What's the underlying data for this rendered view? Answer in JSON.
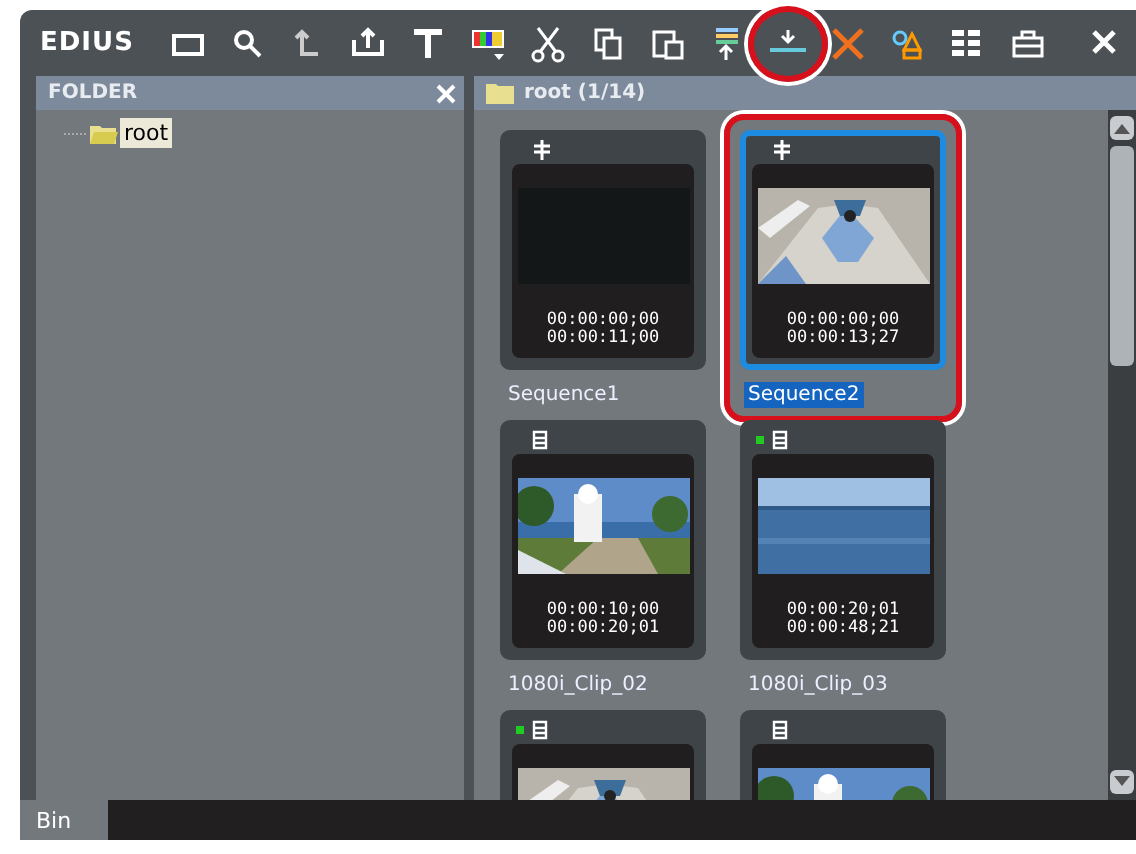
{
  "window": {
    "title": "EDIUS"
  },
  "toolbar": [
    {
      "kind": "new-folder"
    },
    {
      "kind": "search"
    },
    {
      "kind": "up"
    },
    {
      "kind": "export"
    },
    {
      "kind": "text"
    },
    {
      "kind": "color-bars"
    },
    {
      "kind": "cut"
    },
    {
      "kind": "copy"
    },
    {
      "kind": "paste"
    },
    {
      "kind": "add-timeline"
    },
    {
      "kind": "insert",
      "highlighted": true
    },
    {
      "kind": "delete"
    },
    {
      "kind": "properties"
    },
    {
      "kind": "view"
    },
    {
      "kind": "briefcase"
    }
  ],
  "folder_panel": {
    "title": "FOLDER",
    "tree": [
      {
        "label": "root",
        "selected": true
      }
    ]
  },
  "bin": {
    "path": "root (1/14)",
    "clips": [
      {
        "kind": "sequence",
        "name": "Sequence1",
        "in": "00:00:00;00",
        "out": "00:00:11;00",
        "marker": false,
        "selected": false,
        "highlighted": false
      },
      {
        "kind": "sequence",
        "name": "Sequence2",
        "in": "00:00:00;00",
        "out": "00:00:13;27",
        "marker": false,
        "selected": true,
        "highlighted": true
      },
      {
        "kind": "clip",
        "name": "1080i_Clip_02",
        "in": "00:00:10;00",
        "out": "00:00:20;01",
        "marker": false,
        "selected": false,
        "highlighted": false
      },
      {
        "kind": "clip",
        "name": "1080i_Clip_03",
        "in": "00:00:20;01",
        "out": "00:00:48;21",
        "marker": true,
        "selected": false,
        "highlighted": false
      },
      {
        "kind": "clip",
        "marker": true,
        "selected": false,
        "highlighted": false
      },
      {
        "kind": "clip",
        "marker": false,
        "selected": false,
        "highlighted": false
      }
    ]
  },
  "bottom_tabs": [
    {
      "label": "Bin",
      "selected": true
    }
  ]
}
